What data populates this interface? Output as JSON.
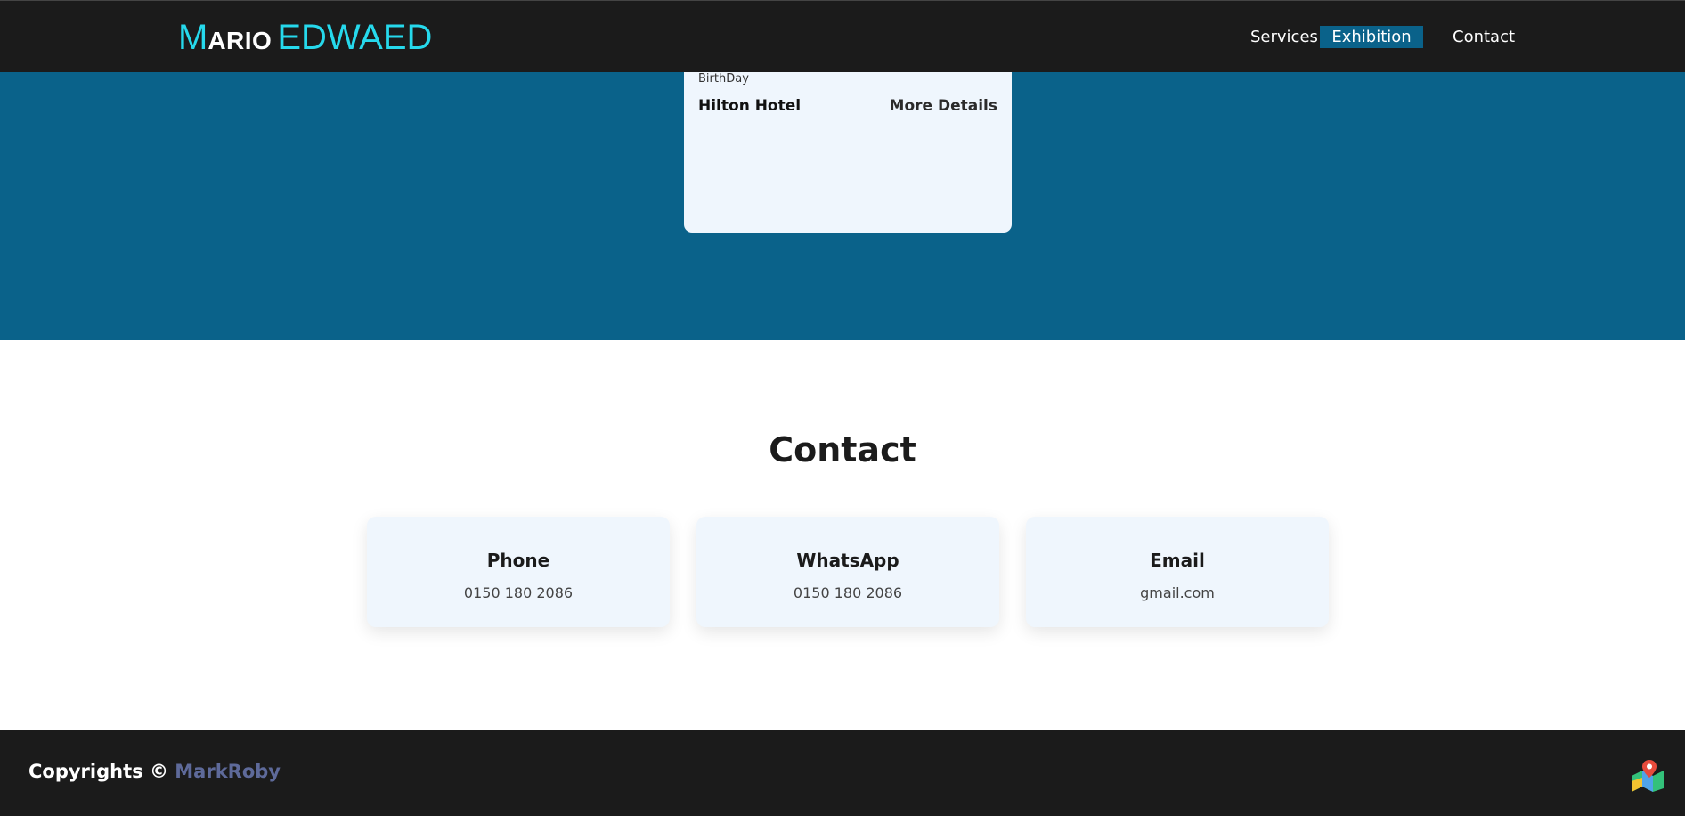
{
  "header": {
    "logo": {
      "first_initial": "M",
      "first_rest": "ARIO",
      "last": "EDWAED"
    },
    "nav": [
      {
        "label": "Services"
      },
      {
        "label": "Exhibition"
      },
      {
        "label": "Contact"
      }
    ]
  },
  "exhibition": {
    "event": {
      "type": "BirthDay",
      "venue": "Hilton Hotel",
      "more_label": "More Details"
    }
  },
  "contact": {
    "title": "Contact",
    "cards": [
      {
        "title": "Phone",
        "value": "0150 180 2086"
      },
      {
        "title": "WhatsApp",
        "value": "0150 180 2086"
      },
      {
        "title": "Email",
        "value": "gmail.com"
      }
    ]
  },
  "footer": {
    "copyright_prefix": "Copyrights ©",
    "author": "MarkRoby",
    "map_icon": "map-pin-icon"
  },
  "colors": {
    "header_bg": "#1b1b1b",
    "accent_cyan": "#26d9ec",
    "band_blue": "#0a628a",
    "card_bg": "#eff6fd",
    "author_color": "#5e6a9a"
  }
}
